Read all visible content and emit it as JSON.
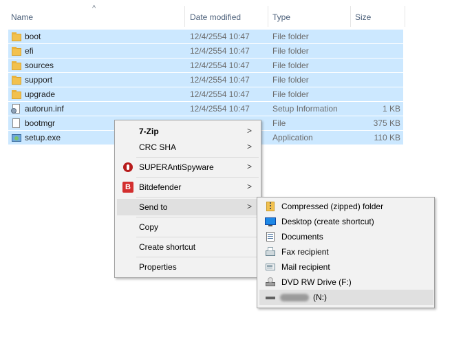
{
  "columns": {
    "name": "Name",
    "date_modified": "Date modified",
    "type": "Type",
    "size": "Size"
  },
  "sort_indicator": "^",
  "files": [
    {
      "name": "boot",
      "date": "12/4/2554 10:47",
      "type": "File folder",
      "size": "",
      "icon": "folder-icon"
    },
    {
      "name": "efi",
      "date": "12/4/2554 10:47",
      "type": "File folder",
      "size": "",
      "icon": "folder-icon"
    },
    {
      "name": "sources",
      "date": "12/4/2554 10:47",
      "type": "File folder",
      "size": "",
      "icon": "folder-icon"
    },
    {
      "name": "support",
      "date": "12/4/2554 10:47",
      "type": "File folder",
      "size": "",
      "icon": "folder-icon"
    },
    {
      "name": "upgrade",
      "date": "12/4/2554 10:47",
      "type": "File folder",
      "size": "",
      "icon": "folder-icon"
    },
    {
      "name": "autorun.inf",
      "date": "12/4/2554 10:47",
      "type": "Setup Information",
      "size": "1 KB",
      "icon": "setup-information-icon"
    },
    {
      "name": "bootmgr",
      "date": "",
      "type": "File",
      "size": "375 KB",
      "icon": "file-icon"
    },
    {
      "name": "setup.exe",
      "date": "",
      "type": "Application",
      "size": "110 KB",
      "icon": "application-icon"
    }
  ],
  "context_menu": {
    "seven_zip": "7-Zip",
    "crc_sha": "CRC SHA",
    "superantispyware": "SUPERAntiSpyware",
    "bitdefender": "Bitdefender",
    "send_to": "Send to",
    "copy": "Copy",
    "create_shortcut": "Create shortcut",
    "properties": "Properties",
    "submenu_arrow": ">",
    "bitdefender_glyph": "B"
  },
  "send_to_menu": {
    "compressed_folder": "Compressed (zipped) folder",
    "desktop": "Desktop (create shortcut)",
    "documents": "Documents",
    "fax": "Fax recipient",
    "mail": "Mail recipient",
    "dvd": "DVD RW Drive (F:)",
    "removable_drive": "(N:)"
  },
  "colors": {
    "selection": "#cce8ff",
    "menu_background": "#f2f2f2",
    "menu_highlight": "#e0e0e0"
  }
}
